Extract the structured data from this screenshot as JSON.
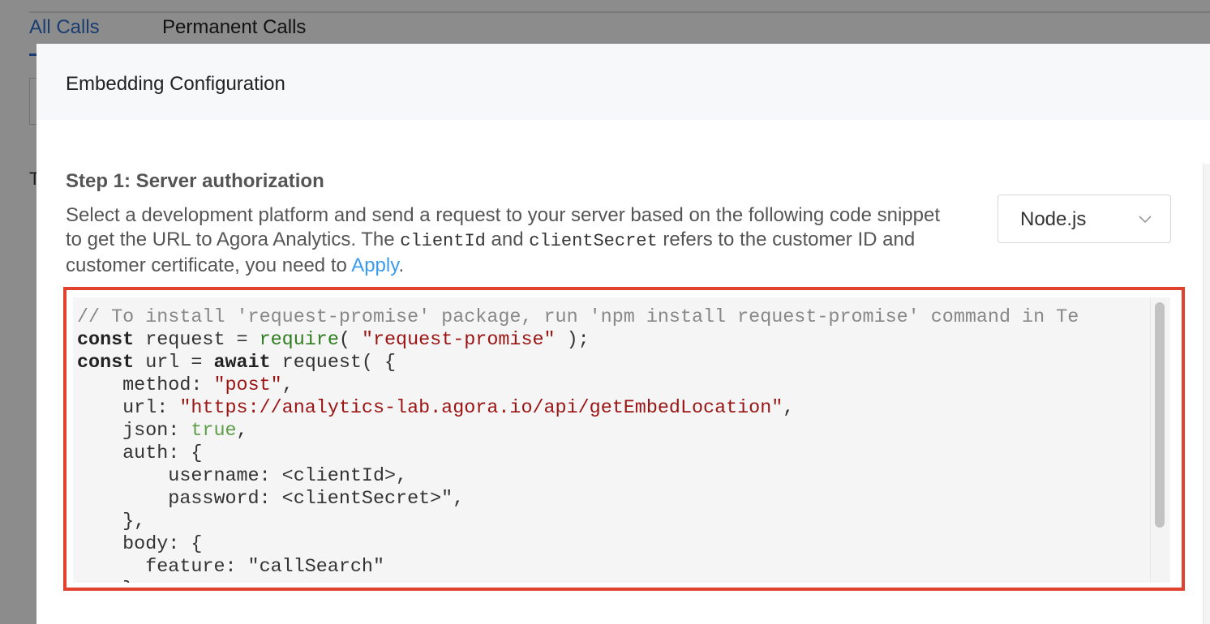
{
  "background": {
    "tabs": [
      "All Calls",
      "Permanent Calls"
    ],
    "active_tab": "All Calls",
    "letter": "T"
  },
  "modal": {
    "title": "Embedding Configuration",
    "step_title": "Step 1: Server authorization",
    "description": {
      "part1": "Select a development platform and send a request to your server based on the following code snippet to get the URL to Agora Analytics. The ",
      "code1": "clientId",
      "part2": " and ",
      "code2": "clientSecret",
      "part3": " refers to the customer ID and customer certificate, you need to ",
      "link": "Apply",
      "part4": "."
    },
    "platform_select": {
      "value": "Node.js",
      "icon": "chevron-down-icon"
    },
    "code": {
      "line1": "// To install 'request-promise' package, run 'npm install request-promise' command in Te",
      "line2": {
        "kw": "const",
        "a": " request = ",
        "fn": "require",
        "b": "( ",
        "str": "\"request-promise\"",
        "c": " );"
      },
      "line3": {
        "kw1": "const",
        "a": " url = ",
        "kw2": "await",
        "b": " request( {"
      },
      "line4": {
        "a": "    method: ",
        "str": "\"post\"",
        "b": ","
      },
      "line5": {
        "a": "    url: ",
        "str": "\"https://analytics-lab.agora.io/api/getEmbedLocation\"",
        "b": ","
      },
      "line6": {
        "a": "    json: ",
        "bool": "true",
        "b": ","
      },
      "line7": "    auth: {",
      "line8": "        username: <clientId>,",
      "line9": "        password: <clientSecret>\",",
      "line10": "    },",
      "line11": "    body: {",
      "line12": "      feature: \"callSearch\"",
      "line13": "    }"
    }
  },
  "colors": {
    "accent_blue": "#2f6fce",
    "link_blue": "#3a9bee",
    "highlight_red": "#e0422e"
  }
}
